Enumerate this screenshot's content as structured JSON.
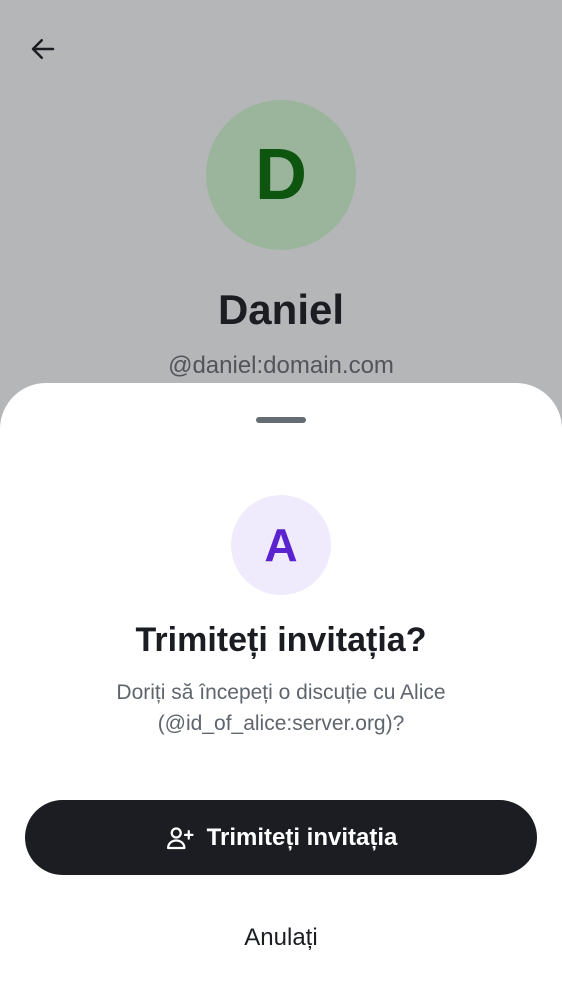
{
  "profile": {
    "avatar_letter": "D",
    "name": "Daniel",
    "handle": "@daniel:domain.com"
  },
  "dialog": {
    "avatar_letter": "A",
    "title": "Trimiteți invitația?",
    "description": "Doriți să începeți o discuție cu Alice (@id_of_alice:server.org)?",
    "confirm_label": "Trimiteți invitația",
    "cancel_label": "Anulați"
  },
  "icons": {
    "back": "arrow-left-icon",
    "confirm": "user-plus-icon"
  },
  "colors": {
    "scrim": "#b5b6b8",
    "profile_avatar_bg": "#9ab59c",
    "profile_avatar_fg": "#0e5510",
    "dialog_avatar_bg": "#efebfc",
    "dialog_avatar_fg": "#5b22cf",
    "primary_button_bg": "#1b1d22"
  }
}
